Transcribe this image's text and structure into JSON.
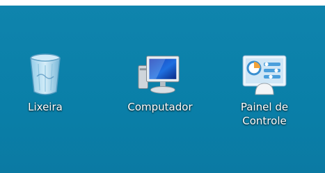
{
  "desktop": {
    "background_color": "#0a7fa8",
    "icons": [
      {
        "label": "Lixeira",
        "icon": "recycle-bin-icon"
      },
      {
        "label": "Computador",
        "icon": "computer-monitor-icon"
      },
      {
        "label": "Painel de\nControle",
        "icon": "control-panel-icon"
      }
    ]
  }
}
